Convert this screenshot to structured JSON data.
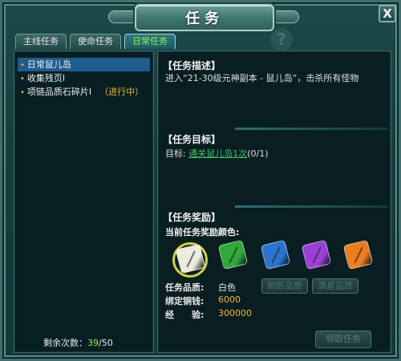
{
  "window": {
    "title": "任务",
    "close_label": "X",
    "help_mark": "?"
  },
  "tabs": [
    {
      "label": "主线任务",
      "active": false
    },
    {
      "label": "使命任务",
      "active": false
    },
    {
      "label": "日常任务",
      "active": true
    }
  ],
  "task_list": {
    "bullet": "•",
    "items": [
      {
        "label": "日常鼠儿岛",
        "status": "",
        "selected": true
      },
      {
        "label": "收集残页Ⅰ",
        "status": "",
        "selected": false
      },
      {
        "label": "项链品质石碎片Ⅰ",
        "status": "（进行中）",
        "selected": false
      }
    ],
    "remaining_label": "剩余次数：",
    "remaining_used": "39",
    "remaining_total": "/50"
  },
  "description": {
    "title": "【任务描述】",
    "text": "进入“21-30级元神副本 - 鼠儿岛”，击杀所有怪物"
  },
  "goal": {
    "title": "【任务目标】",
    "prefix": "目标:",
    "link": "通关鼠儿岛1次",
    "progress": "(0/1)"
  },
  "reward": {
    "title": "【任务奖励】",
    "color_label": "当前任务奖励颜色:",
    "gems": [
      {
        "color": "#ecebdd",
        "selected": true
      },
      {
        "color": "#2fa93a",
        "selected": false
      },
      {
        "color": "#2a74cf",
        "selected": false
      },
      {
        "color": "#9a3fd8",
        "selected": false
      },
      {
        "color": "#ee7d1d",
        "selected": false
      }
    ],
    "quality_label": "任务品质:",
    "quality_value": "白色",
    "money_label": "绑定铜钱:",
    "money_value": "6000",
    "exp_label": "经　　验:",
    "exp_value": "300000",
    "refresh_button": "刷新品质",
    "max_button": "满星品质",
    "accept_button": "领取任务"
  },
  "colors": {
    "accent_green": "#9af03c",
    "link_green": "#38c56a",
    "gold": "#f1b825",
    "selection_blue": "#1d5c8c"
  }
}
